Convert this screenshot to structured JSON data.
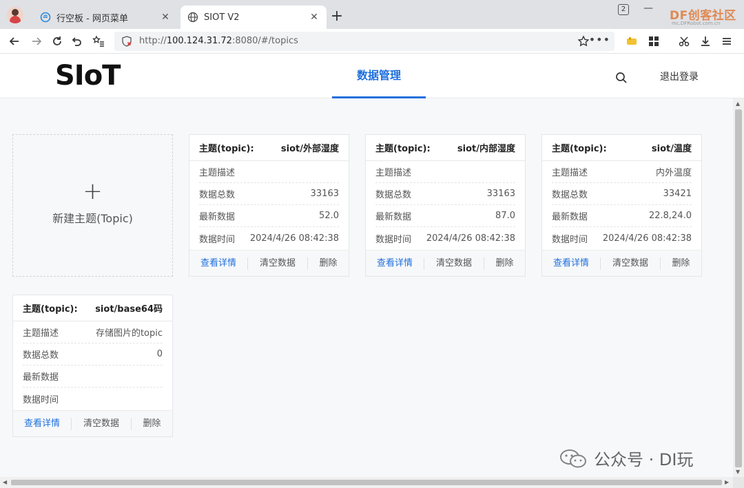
{
  "browser": {
    "tabs": [
      {
        "label": "行空板 - 网页菜单",
        "active": false,
        "icon": "globe-e-icon"
      },
      {
        "label": "SIOT V2",
        "active": true,
        "icon": "globe-icon"
      }
    ],
    "tab_count": "2",
    "url_prefix": "http://",
    "url_host": "100.124.31.72",
    "url_rest": ":8080/#/topics",
    "watermark_brand": "DF创客社区",
    "watermark_sub": "mc.DFRobot.com.cn"
  },
  "header": {
    "logo": "SIoT",
    "nav_tab": "数据管理",
    "logout": "退出登录"
  },
  "new_topic": {
    "plus": "+",
    "label": "新建主题(Topic)"
  },
  "labels": {
    "topic": "主题(topic):",
    "desc": "主题描述",
    "total": "数据总数",
    "latest": "最新数据",
    "time": "数据时间",
    "view": "查看详情",
    "clear": "清空数据",
    "delete": "删除"
  },
  "topics": [
    {
      "name": "siot/外部湿度",
      "desc": "",
      "total": "33163",
      "latest": "52.0",
      "time": "2024/4/26 08:42:38"
    },
    {
      "name": "siot/内部湿度",
      "desc": "",
      "total": "33163",
      "latest": "87.0",
      "time": "2024/4/26 08:42:38"
    },
    {
      "name": "siot/温度",
      "desc": "内外温度",
      "total": "33421",
      "latest": "22.8,24.0",
      "time": "2024/4/26 08:42:38"
    },
    {
      "name": "siot/base64码",
      "desc": "存储图片的topic",
      "total": "0",
      "latest": "",
      "time": ""
    }
  ],
  "watermark": "公众号 · DI玩"
}
